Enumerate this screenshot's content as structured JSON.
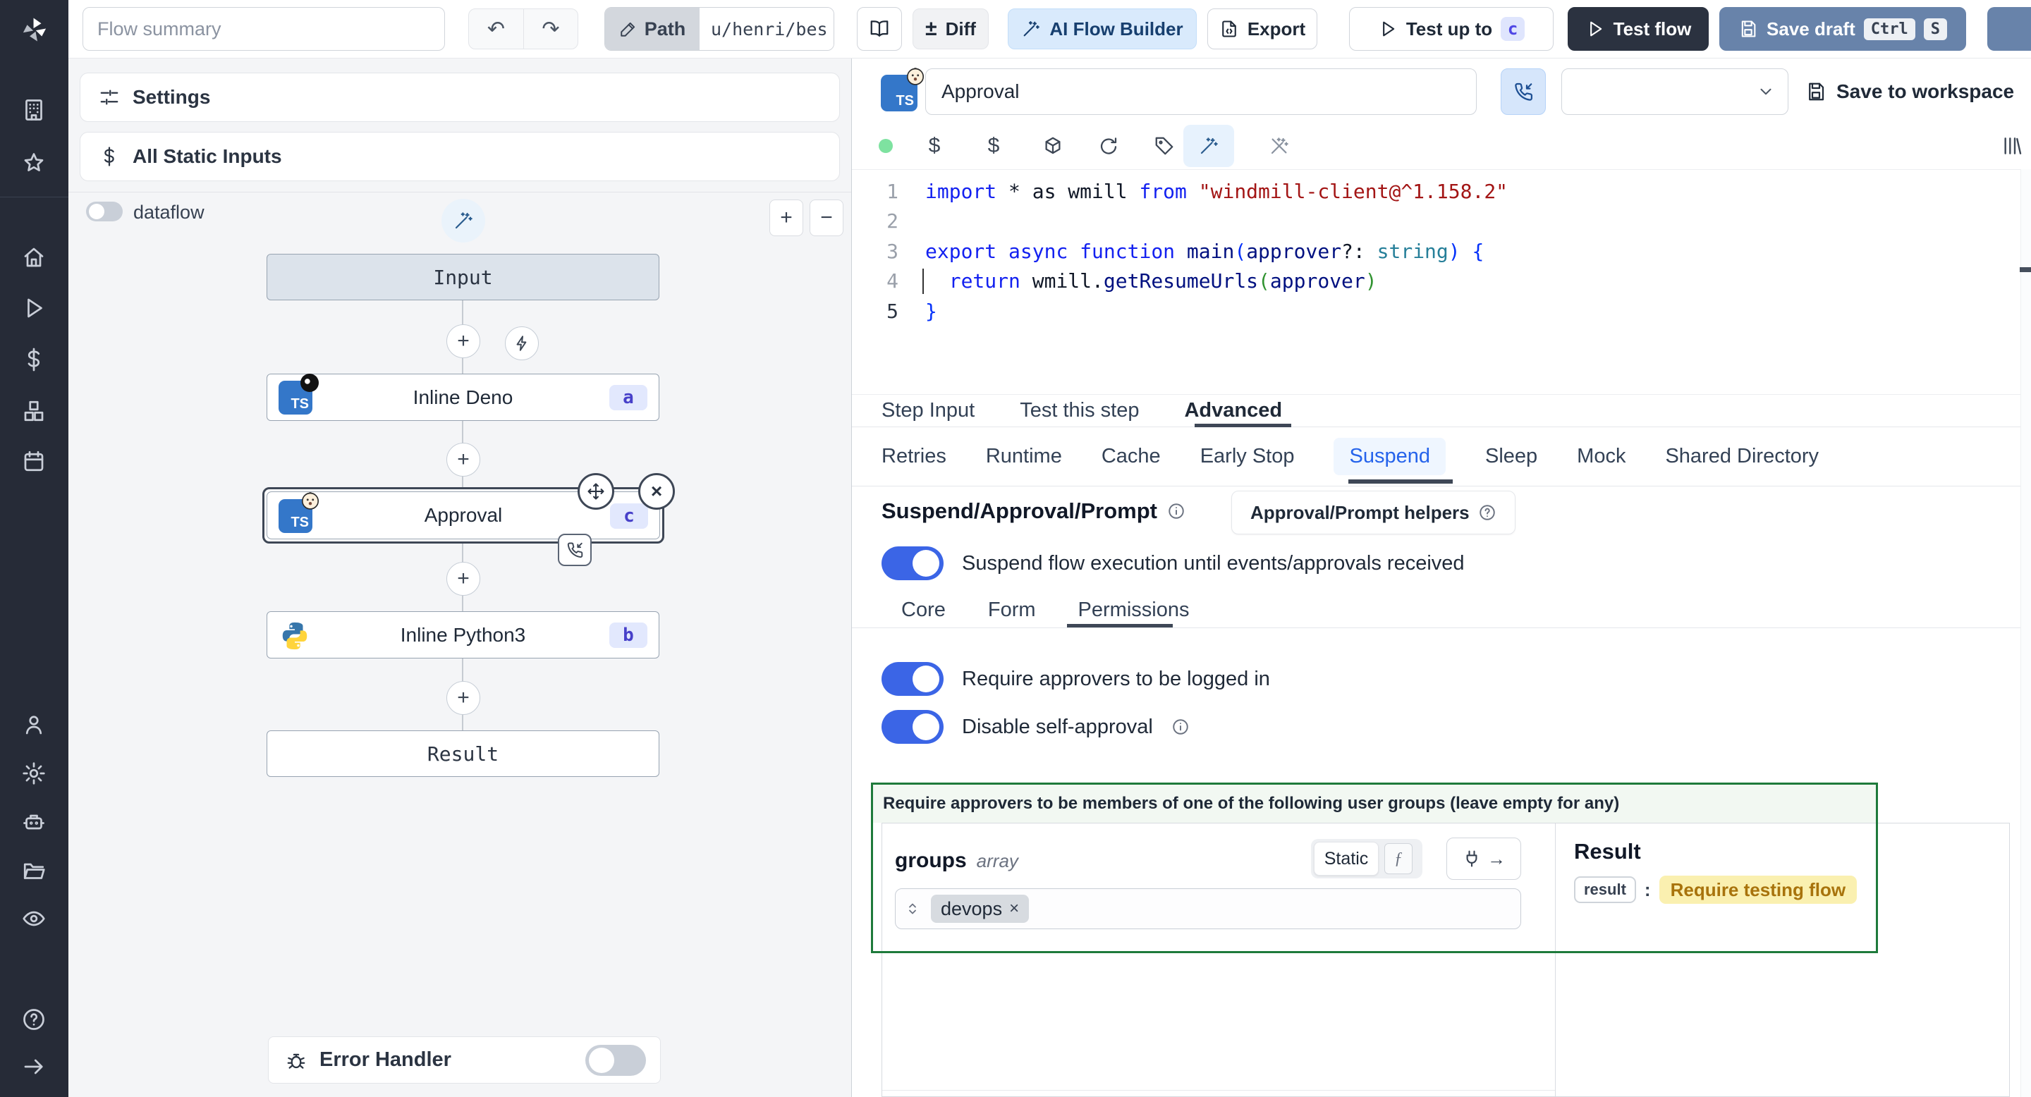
{
  "colors": {
    "accent_blue": "#3b65e6",
    "selection_dark": "#3e4756",
    "green_border": "#1e7a3b",
    "badge_bg": "#e2e8fd",
    "badge_text": "#4740c9",
    "yellow_bg": "#faf0b0",
    "yellow_text": "#a8730c",
    "ai_button_bg": "#d9eafc",
    "save_draft_bg": "#6883aa",
    "test_flow_bg": "#2b3240",
    "status_dot": "#7ee2a0"
  },
  "glyphs": {
    "undo": "↶",
    "redo": "↷",
    "diff": "±",
    "plus": "+",
    "minus": "−",
    "close": "×",
    "arrow": "→",
    "fn": "ƒ",
    "colon": ":",
    "dollar": "$"
  },
  "sidebar": {
    "icons": [
      "building",
      "star",
      "home",
      "play",
      "dollar",
      "cubes",
      "calendar",
      "user",
      "gear",
      "robot",
      "folder",
      "eye",
      "help",
      "arrow-right"
    ]
  },
  "toolbar": {
    "flow_summary_placeholder": "Flow summary",
    "path_label": "Path",
    "path_value": "u/henri/bes",
    "diff_label": "Diff",
    "ai_label": "AI Flow Builder",
    "export_label": "Export",
    "test_up_to_label": "Test up to",
    "test_up_to_badge": "c",
    "test_flow_label": "Test flow",
    "save_draft_label": "Save draft",
    "kbd1": "Ctrl",
    "kbd2": "S"
  },
  "flow": {
    "settings": "Settings",
    "all_static_inputs": "All Static Inputs",
    "dataflow": "dataflow",
    "nodes": {
      "input": {
        "label": "Input"
      },
      "deno": {
        "label": "Inline Deno",
        "badge": "a"
      },
      "approval": {
        "label": "Approval",
        "badge": "c"
      },
      "python": {
        "label": "Inline Python3",
        "badge": "b"
      },
      "result": {
        "label": "Result"
      }
    },
    "error_handler": "Error Handler"
  },
  "editor": {
    "step_name": "Approval",
    "save_to_workspace": "Save to workspace",
    "tabs": [
      {
        "label": "Step Input"
      },
      {
        "label": "Test this step"
      },
      {
        "label": "Advanced"
      }
    ],
    "code": {
      "lines": [
        {
          "num": "1",
          "tokens": [
            {
              "c": "kw",
              "t": "import"
            },
            {
              "c": "pl",
              "t": " * as wmill "
            },
            {
              "c": "kw",
              "t": "from"
            },
            {
              "c": "pl",
              "t": " "
            },
            {
              "c": "str",
              "t": "\"windmill-client@^1.158.2\""
            }
          ]
        },
        {
          "num": "2",
          "tokens": []
        },
        {
          "num": "3",
          "tokens": [
            {
              "c": "kw",
              "t": "export"
            },
            {
              "c": "pl",
              "t": " "
            },
            {
              "c": "kw",
              "t": "async"
            },
            {
              "c": "pl",
              "t": " "
            },
            {
              "c": "kw",
              "t": "function"
            },
            {
              "c": "id",
              "t": " main"
            },
            {
              "c": "b1",
              "t": "("
            },
            {
              "c": "id",
              "t": "approver"
            },
            {
              "c": "pl",
              "t": "?: "
            },
            {
              "c": "ty",
              "t": "string"
            },
            {
              "c": "b1",
              "t": ")"
            },
            {
              "c": "pl",
              "t": " "
            },
            {
              "c": "b1",
              "t": "{"
            }
          ]
        },
        {
          "num": "4",
          "tokens": [
            {
              "c": "pl",
              "t": "  "
            },
            {
              "c": "kw",
              "t": "return"
            },
            {
              "c": "pl",
              "t": " wmill."
            },
            {
              "c": "id",
              "t": "getResumeUrls"
            },
            {
              "c": "b2",
              "t": "("
            },
            {
              "c": "id",
              "t": "approver"
            },
            {
              "c": "b2",
              "t": ")"
            }
          ]
        },
        {
          "num": "5",
          "tokens": [
            {
              "c": "b1",
              "t": "}"
            }
          ]
        }
      ]
    }
  },
  "advanced": {
    "subtabs": [
      {
        "label": "Retries"
      },
      {
        "label": "Runtime"
      },
      {
        "label": "Cache"
      },
      {
        "label": "Early Stop"
      },
      {
        "label": "Suspend"
      },
      {
        "label": "Sleep"
      },
      {
        "label": "Mock"
      },
      {
        "label": "Shared Directory"
      }
    ],
    "suspend": {
      "title": "Suspend/Approval/Prompt",
      "helpers": "Approval/Prompt helpers",
      "toggle_suspend": "Suspend flow execution until events/approvals received",
      "tabs": [
        {
          "label": "Core"
        },
        {
          "label": "Form"
        },
        {
          "label": "Permissions"
        }
      ],
      "toggle_logged_in": "Require approvers to be logged in",
      "toggle_self_approval": "Disable self-approval",
      "box_header": "Require approvers to be members of one of the following user groups (leave empty for any)",
      "field": {
        "name": "groups",
        "type": "array",
        "static_label": "Static",
        "tag": "devops"
      },
      "result": {
        "title": "Result",
        "key": "result",
        "value": "Require testing flow"
      }
    }
  }
}
